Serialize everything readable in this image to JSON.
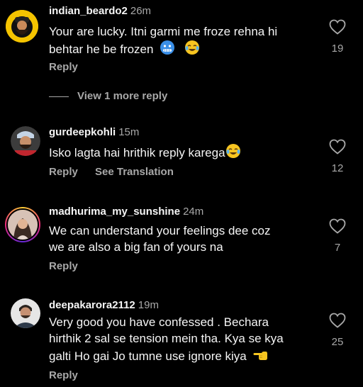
{
  "comments": [
    {
      "username": "indian_beardo2",
      "time": "26m",
      "text_line1": "Your are lucky. Itni garmi me froze rehna hi",
      "text_line2": "behtar he be frozen",
      "emojis": [
        "freezing-face",
        "tears-of-joy"
      ],
      "likes": "19",
      "reply_label": "Reply",
      "view_replies_label": "View 1 more reply"
    },
    {
      "username": "gurdeepkohli",
      "time": "15m",
      "text_line1": "Isko lagta hai hrithik reply karega",
      "emojis": [
        "tears-of-joy"
      ],
      "likes": "12",
      "reply_label": "Reply",
      "translate_label": "See Translation"
    },
    {
      "username": "madhurima_my_sunshine",
      "time": "24m",
      "text_line1": "We can understand your feelings dee coz",
      "text_line2": "we are also a big fan of yours na",
      "likes": "7",
      "reply_label": "Reply"
    },
    {
      "username": "deepakarora2112",
      "time": "19m",
      "text_line1": "Very good you have confessed . Bechara",
      "text_line2": "hirthik 2 sal se tension mein tha. Kya se kya",
      "text_line3": "galti Ho gai Jo tumne use ignore kiya",
      "emojis": [
        "pointing-hand"
      ],
      "likes": "25",
      "reply_label": "Reply"
    }
  ],
  "colors": {
    "background": "#000000",
    "text": "#f5f5f5",
    "secondary": "#a8a8a8"
  }
}
